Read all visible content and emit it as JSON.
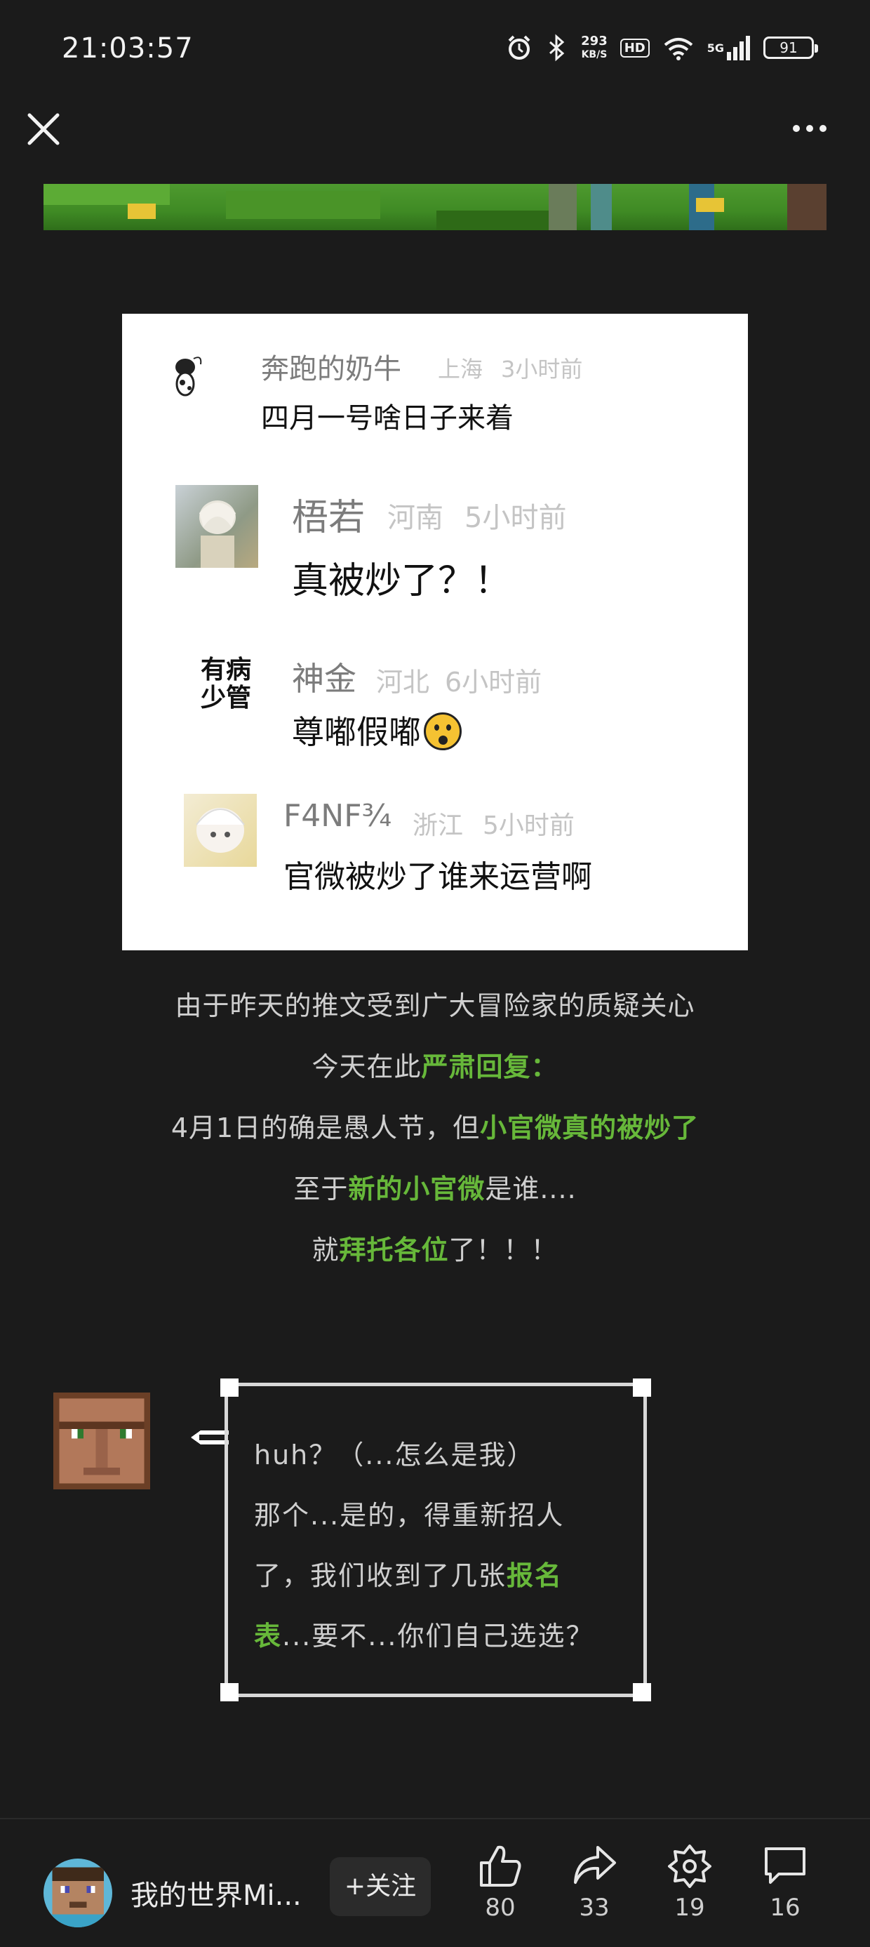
{
  "status_bar": {
    "time": "21:03:57",
    "net_speed_value": "293",
    "net_speed_unit": "KB/S",
    "hd": "HD",
    "network": "5G",
    "battery": "91",
    "icons": [
      "alarm-icon",
      "bluetooth-icon",
      "wifi-icon",
      "signal-icon",
      "battery-icon"
    ]
  },
  "nav": {
    "close_icon": "close-icon",
    "more_icon": "more-icon"
  },
  "comments": [
    {
      "name": "奔跑的奶牛",
      "location": "上海",
      "time": "3小时前",
      "text": "四月一号啥日子来着",
      "avatar": "cow-avatar"
    },
    {
      "name": "梧若",
      "location": "河南",
      "time": "5小时前",
      "text": "真被炒了？！",
      "avatar": "anime-avatar"
    },
    {
      "name": "神金",
      "location": "河北",
      "time": "6小时前",
      "text": "尊嘟假嘟",
      "emoji": "😮",
      "avatar_text": "有病少管"
    },
    {
      "name": "F4NF¾",
      "location": "浙江",
      "time": "5小时前",
      "text": "官微被炒了谁来运营啊",
      "avatar": "anime-avatar-2"
    }
  ],
  "article": {
    "line1": "由于昨天的推文受到广大冒险家的质疑关心",
    "line2_pre": "今天在此",
    "line2_hl": "严肃回复：",
    "line3_pre": "4月1日的确是愚人节，但",
    "line3_hl": "小官微真的被炒了",
    "line4_pre": "至于",
    "line4_hl": "新的小官微",
    "line4_post": "是谁....",
    "line5_pre": "就",
    "line5_hl": "拜托各位",
    "line5_post": "了！！！"
  },
  "speech": {
    "line1": "huh？（...怎么是我）",
    "line2": "那个...是的，得重新招人",
    "line3_pre": "了，我们收到了几张",
    "line3_hl": "报名",
    "line4_hl": "表",
    "line4_post": "...要不...你们自己选选？"
  },
  "bottom_bar": {
    "author": "我的世界Mi...",
    "follow": "+关注",
    "likes": "80",
    "shares": "33",
    "favorites": "19",
    "comments": "16"
  },
  "colors": {
    "accent": "#67b83a",
    "background": "#1b1b1b"
  }
}
